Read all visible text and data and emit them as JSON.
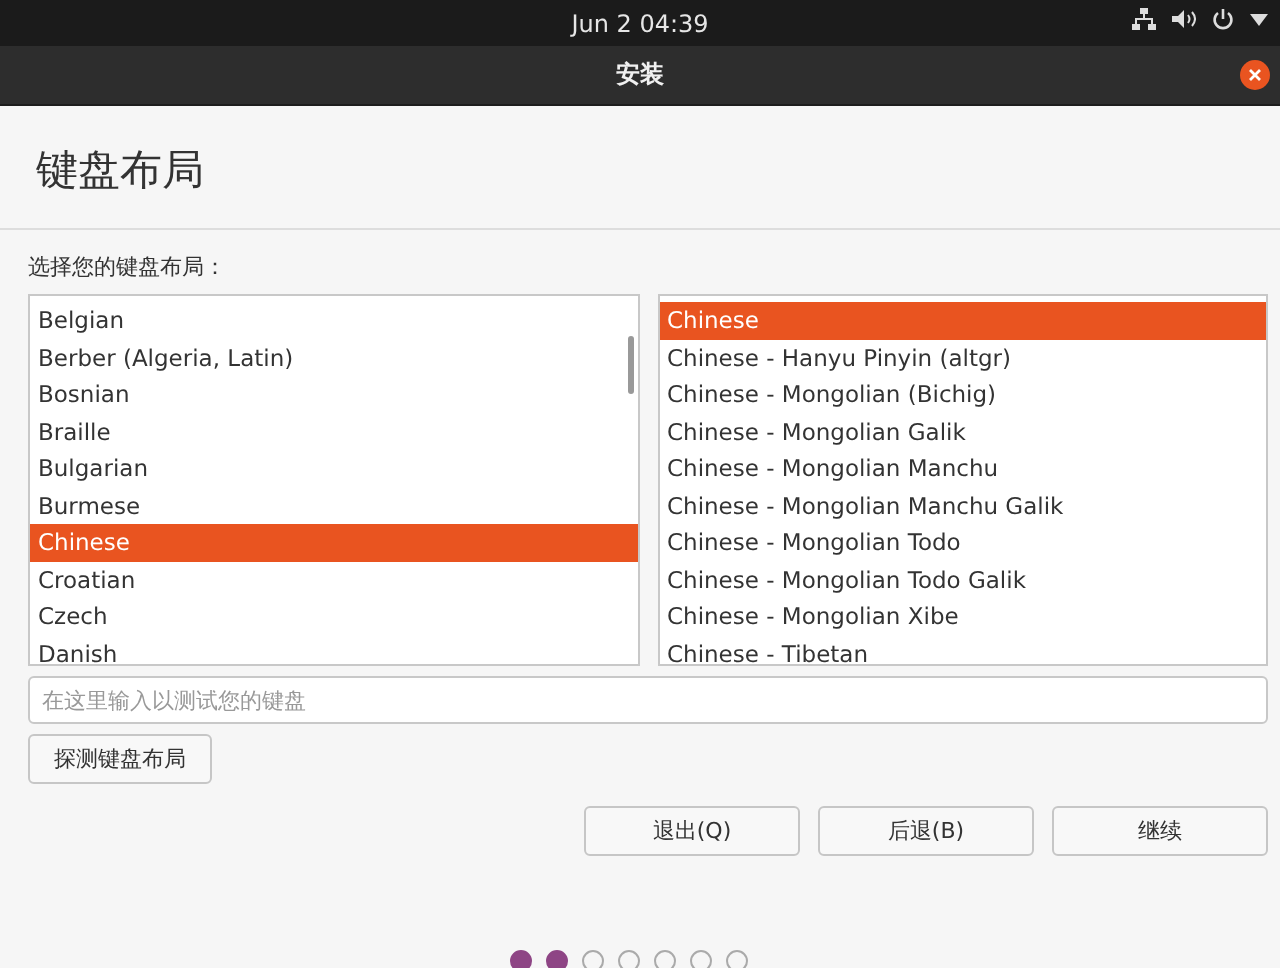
{
  "top_bar": {
    "clock": "Jun 2  04:39"
  },
  "window": {
    "title": "安装"
  },
  "page": {
    "heading": "键盘布局",
    "prompt": "选择您的键盘布局："
  },
  "layouts": [
    {
      "label": "Belgian",
      "selected": false
    },
    {
      "label": "Berber (Algeria, Latin)",
      "selected": false
    },
    {
      "label": "Bosnian",
      "selected": false
    },
    {
      "label": "Braille",
      "selected": false
    },
    {
      "label": "Bulgarian",
      "selected": false
    },
    {
      "label": "Burmese",
      "selected": false
    },
    {
      "label": "Chinese",
      "selected": true
    },
    {
      "label": "Croatian",
      "selected": false
    },
    {
      "label": "Czech",
      "selected": false
    },
    {
      "label": "Danish",
      "selected": false
    }
  ],
  "variants": [
    {
      "label": "Chinese",
      "selected": true
    },
    {
      "label": "Chinese - Hanyu Pinyin (altgr)",
      "selected": false
    },
    {
      "label": "Chinese - Mongolian (Bichig)",
      "selected": false
    },
    {
      "label": "Chinese - Mongolian Galik",
      "selected": false
    },
    {
      "label": "Chinese - Mongolian Manchu",
      "selected": false
    },
    {
      "label": "Chinese - Mongolian Manchu Galik",
      "selected": false
    },
    {
      "label": "Chinese - Mongolian Todo",
      "selected": false
    },
    {
      "label": "Chinese - Mongolian Todo Galik",
      "selected": false
    },
    {
      "label": "Chinese - Mongolian Xibe",
      "selected": false
    },
    {
      "label": "Chinese - Tibetan",
      "selected": false
    }
  ],
  "test_field": {
    "placeholder": "在这里输入以测试您的键盘"
  },
  "detect_button": "探测键盘布局",
  "buttons": [
    "退出(Q)",
    "后退(B)",
    "继续"
  ],
  "progress": [
    {
      "done": true
    },
    {
      "done": true
    },
    {
      "done": false
    },
    {
      "done": false
    },
    {
      "done": false
    },
    {
      "done": false
    },
    {
      "done": false
    }
  ]
}
